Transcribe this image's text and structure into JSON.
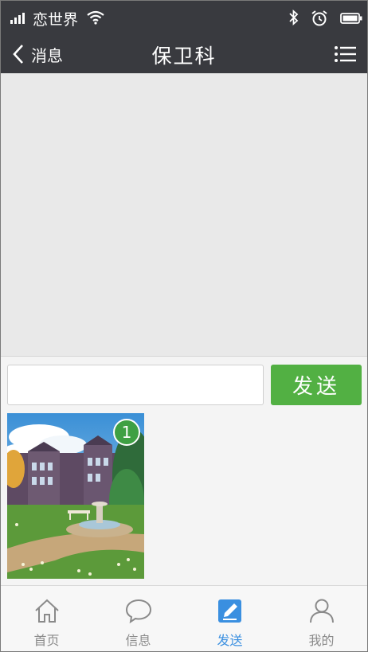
{
  "status_bar": {
    "carrier": "恋世界",
    "icons": [
      "signal-icon",
      "wifi-icon",
      "bluetooth-icon",
      "alarm-icon",
      "battery-icon"
    ]
  },
  "nav": {
    "back_label": "消息",
    "title": "保卫科",
    "menu_icon": "list-icon"
  },
  "compose": {
    "input_value": "",
    "input_placeholder": "",
    "send_label": "发送",
    "image_badge": "1"
  },
  "tabs": [
    {
      "label": "首页",
      "icon": "home-icon",
      "active": false
    },
    {
      "label": "信息",
      "icon": "chat-bubble-icon",
      "active": false
    },
    {
      "label": "发送",
      "icon": "compose-icon",
      "active": true
    },
    {
      "label": "我的",
      "icon": "user-icon",
      "active": false
    }
  ],
  "colors": {
    "header_bg": "#393a3f",
    "send_button": "#52b043",
    "active_tab": "#3a8fe0",
    "inactive_tab": "#8a8a8a"
  }
}
